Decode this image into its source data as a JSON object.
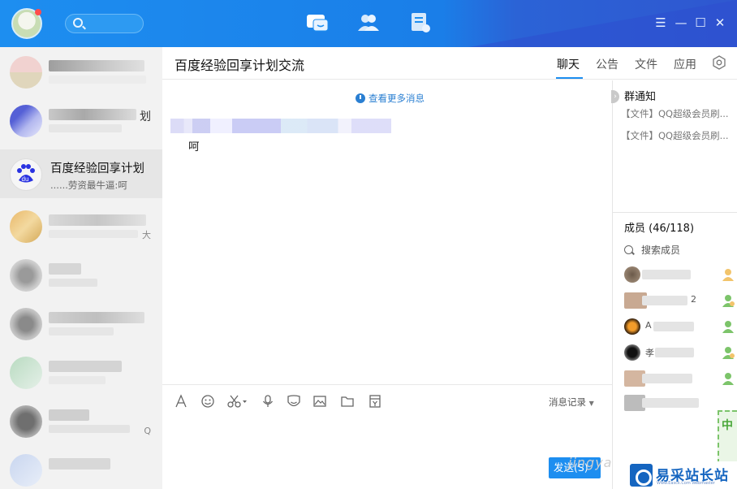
{
  "topbar": {
    "search_placeholder": "",
    "nav": [
      "messages-icon",
      "contacts-icon",
      "space-icon"
    ],
    "window_controls": [
      "menu-icon",
      "minimize-icon",
      "maximize-icon",
      "close-icon"
    ]
  },
  "conversations": [
    {
      "name": "",
      "preview": "",
      "trail": ""
    },
    {
      "name": "",
      "preview": "",
      "trail": "划"
    },
    {
      "name": "百度经验回享计划",
      "preview": "......劳资最牛逼:呵",
      "trail": ""
    },
    {
      "name": "",
      "preview": "",
      "trail": "大"
    },
    {
      "name": "",
      "preview": "",
      "trail": ""
    },
    {
      "name": "",
      "preview": "",
      "trail": ""
    },
    {
      "name": "",
      "preview": "",
      "trail": ""
    },
    {
      "name": "",
      "preview": "",
      "trail": "Q"
    },
    {
      "name": "",
      "preview": "",
      "trail": ""
    }
  ],
  "chat": {
    "title": "百度经验回享计划交流",
    "tabs": [
      "聊天",
      "公告",
      "文件",
      "应用"
    ],
    "active_tab": "聊天",
    "more_messages": "查看更多消息",
    "messages": [
      {
        "text": "呵"
      }
    ],
    "toolbar_icons": [
      "font-icon",
      "emoji-icon",
      "scissors-icon",
      "microphone-icon",
      "sticker-icon",
      "image-icon",
      "folder-icon",
      "red-packet-icon"
    ],
    "history_label": "消息记录",
    "send_label": "发送(S)",
    "watermark": "jingyan."
  },
  "right": {
    "notice_title": "群通知",
    "notices": [
      "【文件】QQ超级会员刷...",
      "【文件】QQ超级会员刷..."
    ],
    "members_title": "成员 (46/118)",
    "member_search_placeholder": "搜索成员",
    "members": [
      {
        "name": ""
      },
      {
        "name": "2"
      },
      {
        "name": "A"
      },
      {
        "name": "孝"
      },
      {
        "name": ""
      },
      {
        "name": ""
      }
    ]
  },
  "watermark_logo": {
    "text": "易采站长站",
    "sub": "Www.Easck.Com Webmaster"
  }
}
